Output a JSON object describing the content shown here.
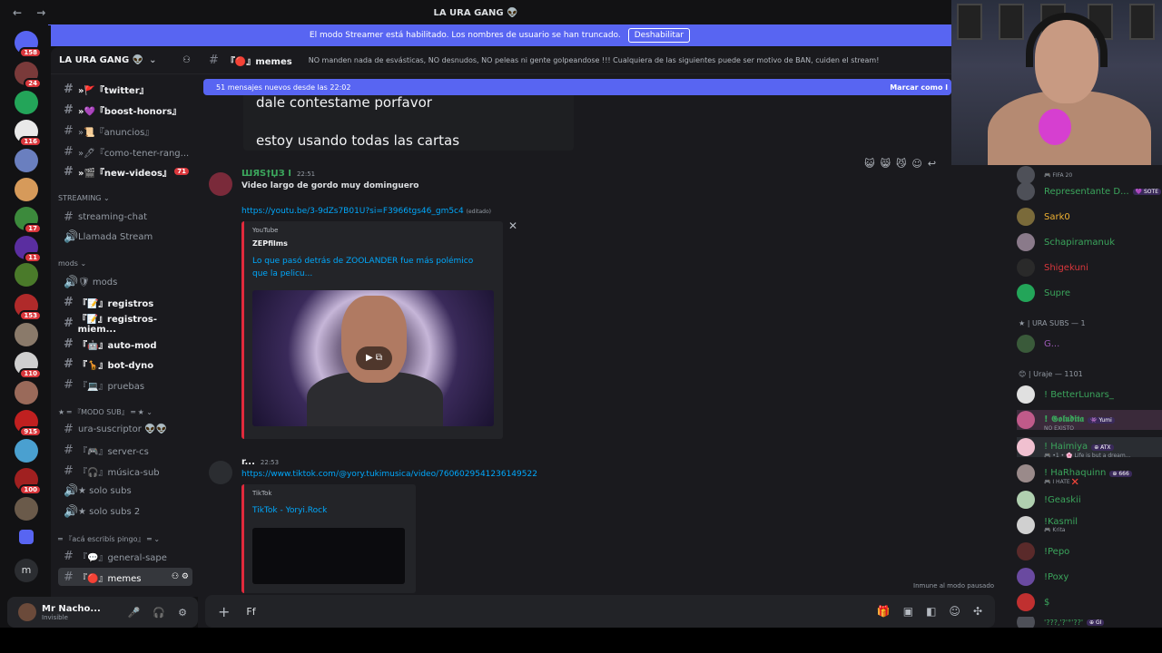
{
  "window": {
    "title": "LA URA GANG 👽",
    "nav_arrows": "← →"
  },
  "streamer_bar": {
    "text": "El modo Streamer está habilitado. Los nombres de usuario se han truncado.",
    "button": "Deshabilitar"
  },
  "servers": {
    "badges": [
      "158",
      "24",
      "",
      "116",
      "",
      "17",
      "11",
      "",
      "153",
      "",
      "110",
      "",
      "915",
      "",
      "100",
      ""
    ]
  },
  "guild": {
    "name": "LA URA GANG 👽"
  },
  "channels": [
    {
      "label": "»🚩『twitter』",
      "bold": true
    },
    {
      "label": "»💜『boost-honors』",
      "bold": true
    },
    {
      "label": "»📜『anuncios』",
      "bold": false
    },
    {
      "label": "»🖊『como-tener-rang...",
      "bold": false
    },
    {
      "label": "»🎬『new-videos』",
      "bold": true,
      "count": "71"
    }
  ],
  "categories": {
    "streaming": "STREAMING ⌄",
    "mods": "mods ⌄",
    "modo_sub": "★ ═ 『MODO SUB』 ═ ★ ⌄",
    "aca": "═ 『acá escribís pingo』 ═ ⌄"
  },
  "streaming_channels": [
    {
      "label": "streaming-chat",
      "type": "text"
    },
    {
      "label": "Llamada Stream",
      "type": "voice"
    }
  ],
  "mod_channels": [
    {
      "label": "🛡 mods",
      "type": "voice"
    },
    {
      "label": "『📝』registros",
      "type": "text",
      "bold": true
    },
    {
      "label": "『📝』registros-miem...",
      "type": "text",
      "bold": true
    },
    {
      "label": "『🤖』auto-mod",
      "type": "text",
      "bold": true
    },
    {
      "label": "『🦒』bot-dyno",
      "type": "text",
      "bold": true
    },
    {
      "label": "『💻』pruebas",
      "type": "text"
    }
  ],
  "sub_channels": [
    {
      "label": "ura-suscriptor 👽👽",
      "type": "text"
    },
    {
      "label": "『🎮』server-cs",
      "type": "text"
    },
    {
      "label": "『🎧』música-sub",
      "type": "text"
    },
    {
      "label": "★ solo subs",
      "type": "voice"
    },
    {
      "label": "★ solo subs 2",
      "type": "voice"
    }
  ],
  "aca_channels": [
    {
      "label": "『💬』general-sape",
      "type": "text"
    },
    {
      "label": "『🔴』memes",
      "type": "text",
      "active": true
    }
  ],
  "user": {
    "name": "Mr Nacho...",
    "status": "Invisible"
  },
  "channel_header": {
    "name": "『🔴』memes",
    "topic": "NO manden nada de esvásticas, NO desnudos, NO peleas ni gente golpeandose !!! Cualquiera de las siguientes puede ser motivo de BAN, cuiden el stream!"
  },
  "new_messages": {
    "text": "51 mensajes nuevos desde las 22:02",
    "action": "Marcar como l"
  },
  "old_message": {
    "line1": "dale contestame porfavor",
    "line2": "estoy usando todas las cartas"
  },
  "message1": {
    "author": "ШЯЅ†ЏЗ Ӏ",
    "time": "22:51",
    "text": "Video largo de gordo muy dominguero",
    "link": "https://youtu.be/3-9dZs7B01U?si=F3966tgs46_gm5c4",
    "edited": "(editado)",
    "embed": {
      "provider": "YouTube",
      "author": "ZEPfilms",
      "title": "Lo que pasó detrás de ZOOLANDER fue más polémico que la pelicu..."
    }
  },
  "message2": {
    "author": "r...",
    "time": "22:53",
    "link": "https://www.tiktok.com/@yory.tukimusica/video/7606029541236149522",
    "embed": {
      "provider": "TikTok",
      "title": "TikTok - Yoryi.Rock"
    }
  },
  "composer": {
    "value": "Ff",
    "paused_note": "Inmune al modo pausado"
  },
  "members": [
    {
      "name": "",
      "sub": "🎮 FIFA 20",
      "color": "#949ba4"
    },
    {
      "name": "Representante D...",
      "tag": "💜 SOTE",
      "color": "#3ba55c"
    },
    {
      "name": "Sark0",
      "color": "#f0b232"
    },
    {
      "name": "Schapiramanuk",
      "color": "#3ba55c"
    },
    {
      "name": "Shigekuni",
      "color": "#da373c"
    },
    {
      "name": "Supre",
      "color": "#3ba55c"
    }
  ],
  "member_groups": {
    "ura_subs": "★ | URA SUBS — 1",
    "uraje": "😊 | Uraje — 1101"
  },
  "sub_members": [
    {
      "name": "G...",
      "color": "#9b59b6"
    }
  ],
  "uraje_members": [
    {
      "name": "! BetterLunars_",
      "color": "#3ba55c"
    },
    {
      "name": "! 𝕲𝖔𝖑𝖚𝖉𝖎𝖙𝖆",
      "sub": "NO EXISTO",
      "tag": "👾 Yumi",
      "color": "#3ba55c"
    },
    {
      "name": "! Haimiya",
      "sub": "🎮 •1 • 🌸 Life is but a dream...",
      "tag": "⊕ ATX",
      "color": "#3ba55c"
    },
    {
      "name": "! HaRhaquinn",
      "sub": "🎮 I HATE ❌",
      "tag": "⊕ 666",
      "color": "#3ba55c"
    },
    {
      "name": "!Geaskii",
      "color": "#3ba55c"
    },
    {
      "name": "!Kasmil",
      "sub": "🎮 Krita",
      "color": "#3ba55c"
    },
    {
      "name": "!Pepo",
      "color": "#3ba55c"
    },
    {
      "name": "!Poxy",
      "color": "#3ba55c"
    },
    {
      "name": "$",
      "color": "#3ba55c"
    },
    {
      "name": "'???,'?'°'??'",
      "tag": "⊕ GI",
      "color": "#3ba55c"
    }
  ],
  "icons": {
    "hash": "#",
    "voice": "🔊",
    "plus": "+",
    "mic": "🎤",
    "headset": "🎧",
    "gear": "⚙",
    "close": "✕"
  }
}
